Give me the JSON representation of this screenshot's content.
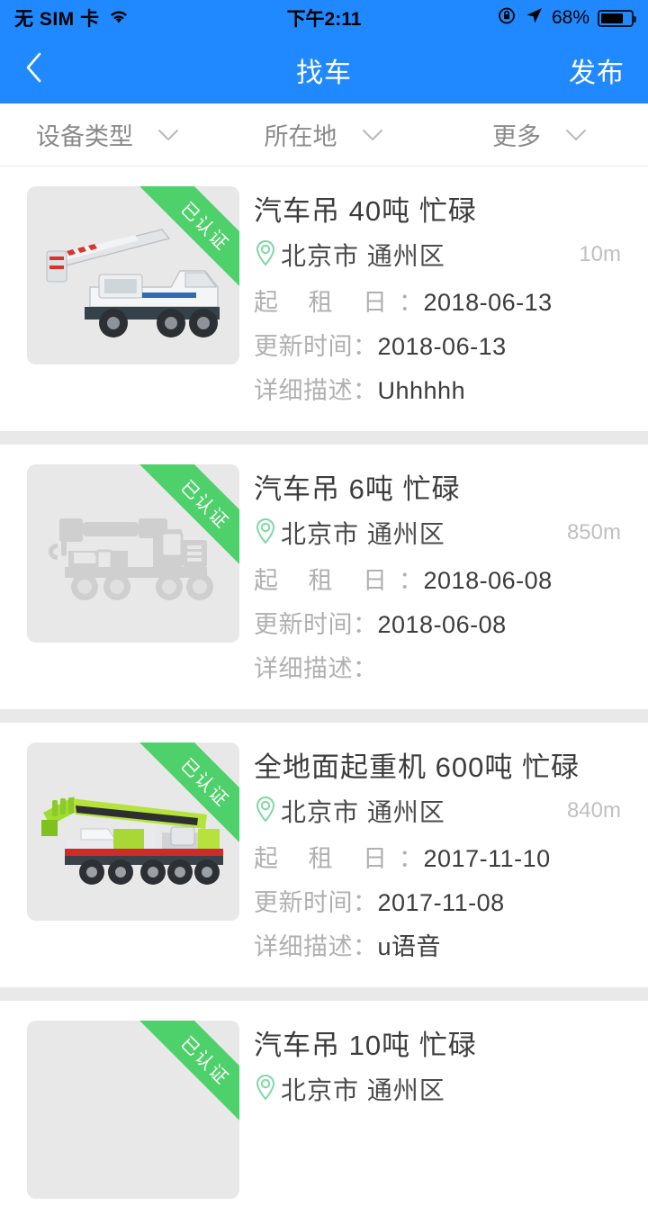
{
  "statusbar": {
    "carrier": "无 SIM 卡",
    "time": "下午2:11",
    "battery_percent": "68%",
    "wifi_icon": "wifi-icon",
    "rotation_lock_icon": "rotation-lock-icon",
    "location_arrow_icon": "location-arrow-icon",
    "battery_icon": "battery-icon"
  },
  "navbar": {
    "back_icon": "chevron-left-icon",
    "title": "找车",
    "action_label": "发布",
    "background": "#2089ff"
  },
  "filters": [
    {
      "label": "设备类型",
      "icon": "chevron-down-icon"
    },
    {
      "label": "所在地",
      "icon": "chevron-down-icon"
    },
    {
      "label": "更多",
      "icon": "chevron-down-icon"
    }
  ],
  "labels": {
    "rent_date": "起 租 日",
    "update_time": "更新时间",
    "description": "详细描述",
    "colon": "：",
    "verified_badge": "已认证",
    "pin_icon": "map-pin-icon"
  },
  "colors": {
    "accent": "#2089ff",
    "badge_green": "#4ed06a",
    "pin_green": "#7fd8a3",
    "muted_text": "#b0b0b0",
    "title_text": "#3c3c3c"
  },
  "listings": [
    {
      "title": "汽车吊 40吨 忙碌",
      "location": "北京市 通州区",
      "distance": "10m",
      "rent_date": "2018-06-13",
      "update_time": "2018-06-13",
      "description": "Uhhhhh",
      "verified": "已认证",
      "image_kind": "photo-white-truck-crane"
    },
    {
      "title": "汽车吊 6吨 忙碌",
      "location": "北京市 通州区",
      "distance": "850m",
      "rent_date": "2018-06-08",
      "update_time": "2018-06-08",
      "description": "",
      "verified": "已认证",
      "image_kind": "placeholder-crane-silhouette"
    },
    {
      "title": "全地面起重机 600吨 忙碌",
      "location": "北京市 通州区",
      "distance": "840m",
      "rent_date": "2017-11-10",
      "update_time": "2017-11-08",
      "description": "u语音",
      "verified": "已认证",
      "image_kind": "photo-green-all-terrain-crane"
    },
    {
      "title": "汽车吊 10吨 忙碌",
      "location": "北京市 通州区",
      "distance": "",
      "rent_date": "",
      "update_time": "",
      "description": "",
      "verified": "已认证",
      "image_kind": "photo-truck-crane"
    }
  ]
}
